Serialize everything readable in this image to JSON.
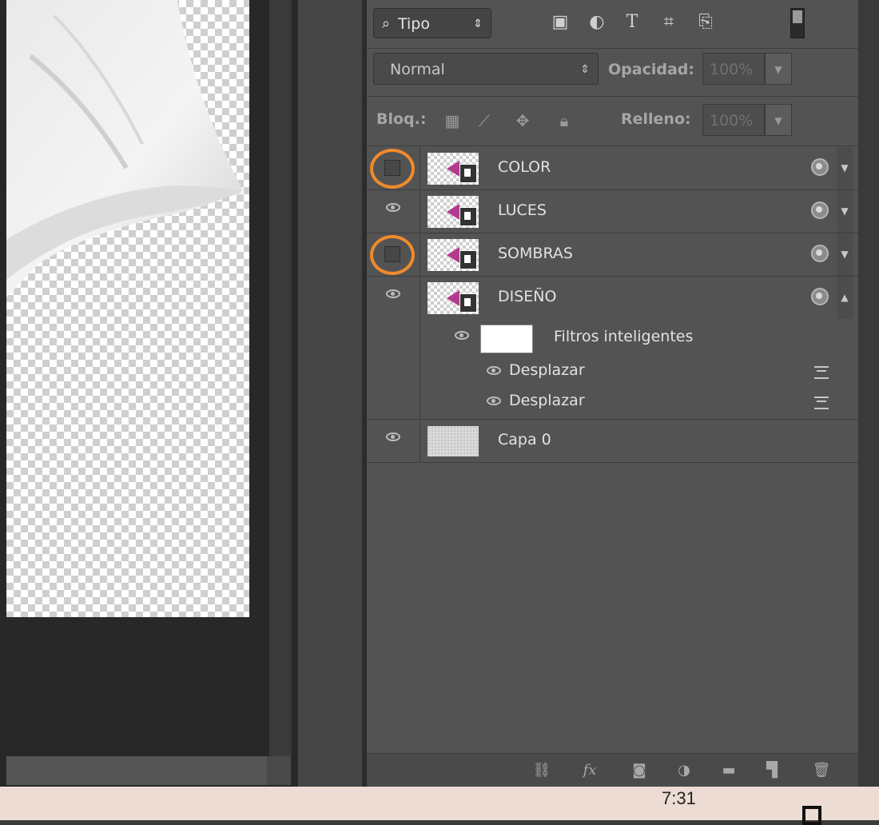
{
  "filter": {
    "kind_label": "Tipo"
  },
  "blend": {
    "mode": "Normal",
    "opacity_label": "Opacidad:",
    "opacity_value": "100%"
  },
  "lock": {
    "label": "Bloq.:",
    "fill_label": "Relleno:",
    "fill_value": "100%"
  },
  "layers": [
    {
      "name": "COLOR",
      "visible": false,
      "highlighted": true
    },
    {
      "name": "LUCES",
      "visible": true,
      "highlighted": false
    },
    {
      "name": "SOMBRAS",
      "visible": false,
      "highlighted": true
    },
    {
      "name": "DISEÑO",
      "visible": true,
      "highlighted": false
    }
  ],
  "smart_filters": {
    "label": "Filtros inteligentes",
    "items": [
      {
        "name": "Desplazar"
      },
      {
        "name": "Desplazar"
      }
    ]
  },
  "base_layer": {
    "name": "Capa 0"
  },
  "taskbar": {
    "time": "7:31"
  },
  "colors": {
    "highlight_ring": "#f08a2c",
    "thumb_accent": "#b23a8f"
  }
}
